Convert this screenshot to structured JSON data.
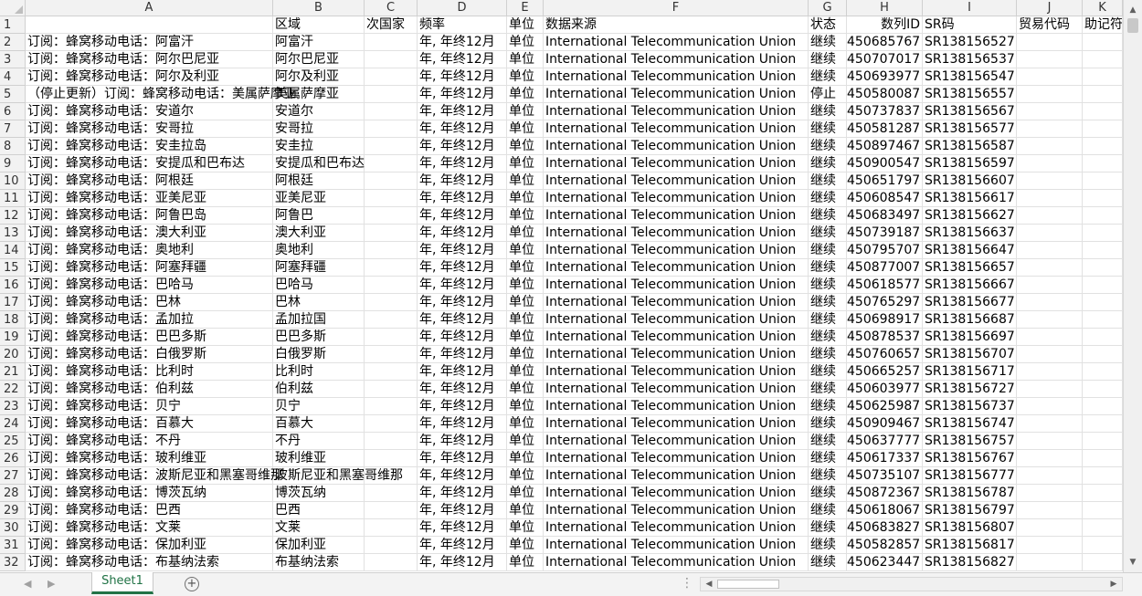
{
  "columns": [
    "A",
    "B",
    "C",
    "D",
    "E",
    "F",
    "G",
    "H",
    "I",
    "J",
    "K"
  ],
  "header_row": {
    "num": "1",
    "cells": [
      "",
      "区域",
      "次国家",
      "频率",
      "单位",
      "数据来源",
      "状态",
      "数列ID",
      "SR码",
      "贸易代码",
      "助记符"
    ]
  },
  "rows": [
    {
      "num": "2",
      "a": "订阅：蜂窝移动电话：阿富汗",
      "b": "阿富汗",
      "d": "年, 年终12月",
      "e": "单位",
      "f": "International Telecommunication Union",
      "g": "继续",
      "h": "450685767",
      "i": "SR138156527"
    },
    {
      "num": "3",
      "a": "订阅：蜂窝移动电话：阿尔巴尼亚",
      "b": "阿尔巴尼亚",
      "d": "年, 年终12月",
      "e": "单位",
      "f": "International Telecommunication Union",
      "g": "继续",
      "h": "450707017",
      "i": "SR138156537"
    },
    {
      "num": "4",
      "a": "订阅：蜂窝移动电话：阿尔及利亚",
      "b": "阿尔及利亚",
      "d": "年, 年终12月",
      "e": "单位",
      "f": "International Telecommunication Union",
      "g": "继续",
      "h": "450693977",
      "i": "SR138156547"
    },
    {
      "num": "5",
      "a": "（停止更新）订阅：蜂窝移动电话：美属萨摩亚",
      "b": "美属萨摩亚",
      "d": "年, 年终12月",
      "e": "单位",
      "f": "International Telecommunication Union",
      "g": "停止",
      "h": "450580087",
      "i": "SR138156557"
    },
    {
      "num": "6",
      "a": "订阅：蜂窝移动电话：安道尔",
      "b": "安道尔",
      "d": "年, 年终12月",
      "e": "单位",
      "f": "International Telecommunication Union",
      "g": "继续",
      "h": "450737837",
      "i": "SR138156567"
    },
    {
      "num": "7",
      "a": "订阅：蜂窝移动电话：安哥拉",
      "b": "安哥拉",
      "d": "年, 年终12月",
      "e": "单位",
      "f": "International Telecommunication Union",
      "g": "继续",
      "h": "450581287",
      "i": "SR138156577"
    },
    {
      "num": "8",
      "a": "订阅：蜂窝移动电话：安圭拉岛",
      "b": "安圭拉",
      "d": "年, 年终12月",
      "e": "单位",
      "f": "International Telecommunication Union",
      "g": "继续",
      "h": "450897467",
      "i": "SR138156587"
    },
    {
      "num": "9",
      "a": "订阅：蜂窝移动电话：安提瓜和巴布达",
      "b": "安提瓜和巴布达",
      "d": "年, 年终12月",
      "e": "单位",
      "f": "International Telecommunication Union",
      "g": "继续",
      "h": "450900547",
      "i": "SR138156597"
    },
    {
      "num": "10",
      "a": "订阅：蜂窝移动电话：阿根廷",
      "b": "阿根廷",
      "d": "年, 年终12月",
      "e": "单位",
      "f": "International Telecommunication Union",
      "g": "继续",
      "h": "450651797",
      "i": "SR138156607"
    },
    {
      "num": "11",
      "a": "订阅：蜂窝移动电话：亚美尼亚",
      "b": "亚美尼亚",
      "d": "年, 年终12月",
      "e": "单位",
      "f": "International Telecommunication Union",
      "g": "继续",
      "h": "450608547",
      "i": "SR138156617"
    },
    {
      "num": "12",
      "a": "订阅：蜂窝移动电话：阿鲁巴岛",
      "b": "阿鲁巴",
      "d": "年, 年终12月",
      "e": "单位",
      "f": "International Telecommunication Union",
      "g": "继续",
      "h": "450683497",
      "i": "SR138156627"
    },
    {
      "num": "13",
      "a": "订阅：蜂窝移动电话：澳大利亚",
      "b": "澳大利亚",
      "d": "年, 年终12月",
      "e": "单位",
      "f": "International Telecommunication Union",
      "g": "继续",
      "h": "450739187",
      "i": "SR138156637"
    },
    {
      "num": "14",
      "a": "订阅：蜂窝移动电话：奥地利",
      "b": "奥地利",
      "d": "年, 年终12月",
      "e": "单位",
      "f": "International Telecommunication Union",
      "g": "继续",
      "h": "450795707",
      "i": "SR138156647"
    },
    {
      "num": "15",
      "a": "订阅：蜂窝移动电话：阿塞拜疆",
      "b": "阿塞拜疆",
      "d": "年, 年终12月",
      "e": "单位",
      "f": "International Telecommunication Union",
      "g": "继续",
      "h": "450877007",
      "i": "SR138156657"
    },
    {
      "num": "16",
      "a": "订阅：蜂窝移动电话：巴哈马",
      "b": "巴哈马",
      "d": "年, 年终12月",
      "e": "单位",
      "f": "International Telecommunication Union",
      "g": "继续",
      "h": "450618577",
      "i": "SR138156667"
    },
    {
      "num": "17",
      "a": "订阅：蜂窝移动电话：巴林",
      "b": "巴林",
      "d": "年, 年终12月",
      "e": "单位",
      "f": "International Telecommunication Union",
      "g": "继续",
      "h": "450765297",
      "i": "SR138156677"
    },
    {
      "num": "18",
      "a": "订阅：蜂窝移动电话：孟加拉",
      "b": "孟加拉国",
      "d": "年, 年终12月",
      "e": "单位",
      "f": "International Telecommunication Union",
      "g": "继续",
      "h": "450698917",
      "i": "SR138156687"
    },
    {
      "num": "19",
      "a": "订阅：蜂窝移动电话：巴巴多斯",
      "b": "巴巴多斯",
      "d": "年, 年终12月",
      "e": "单位",
      "f": "International Telecommunication Union",
      "g": "继续",
      "h": "450878537",
      "i": "SR138156697"
    },
    {
      "num": "20",
      "a": "订阅：蜂窝移动电话：白俄罗斯",
      "b": "白俄罗斯",
      "d": "年, 年终12月",
      "e": "单位",
      "f": "International Telecommunication Union",
      "g": "继续",
      "h": "450760657",
      "i": "SR138156707"
    },
    {
      "num": "21",
      "a": "订阅：蜂窝移动电话：比利时",
      "b": "比利时",
      "d": "年, 年终12月",
      "e": "单位",
      "f": "International Telecommunication Union",
      "g": "继续",
      "h": "450665257",
      "i": "SR138156717"
    },
    {
      "num": "22",
      "a": "订阅：蜂窝移动电话：伯利兹",
      "b": "伯利兹",
      "d": "年, 年终12月",
      "e": "单位",
      "f": "International Telecommunication Union",
      "g": "继续",
      "h": "450603977",
      "i": "SR138156727"
    },
    {
      "num": "23",
      "a": "订阅：蜂窝移动电话：贝宁",
      "b": "贝宁",
      "d": "年, 年终12月",
      "e": "单位",
      "f": "International Telecommunication Union",
      "g": "继续",
      "h": "450625987",
      "i": "SR138156737"
    },
    {
      "num": "24",
      "a": "订阅：蜂窝移动电话：百慕大",
      "b": "百慕大",
      "d": "年, 年终12月",
      "e": "单位",
      "f": "International Telecommunication Union",
      "g": "继续",
      "h": "450909467",
      "i": "SR138156747"
    },
    {
      "num": "25",
      "a": "订阅：蜂窝移动电话：不丹",
      "b": "不丹",
      "d": "年, 年终12月",
      "e": "单位",
      "f": "International Telecommunication Union",
      "g": "继续",
      "h": "450637777",
      "i": "SR138156757"
    },
    {
      "num": "26",
      "a": "订阅：蜂窝移动电话：玻利维亚",
      "b": "玻利维亚",
      "d": "年, 年终12月",
      "e": "单位",
      "f": "International Telecommunication Union",
      "g": "继续",
      "h": "450617337",
      "i": "SR138156767"
    },
    {
      "num": "27",
      "a": "订阅：蜂窝移动电话：波斯尼亚和黑塞哥维那",
      "b": "波斯尼亚和黑塞哥维那",
      "d": "年, 年终12月",
      "e": "单位",
      "f": "International Telecommunication Union",
      "g": "继续",
      "h": "450735107",
      "i": "SR138156777"
    },
    {
      "num": "28",
      "a": "订阅：蜂窝移动电话：博茨瓦纳",
      "b": "博茨瓦纳",
      "d": "年, 年终12月",
      "e": "单位",
      "f": "International Telecommunication Union",
      "g": "继续",
      "h": "450872367",
      "i": "SR138156787"
    },
    {
      "num": "29",
      "a": "订阅：蜂窝移动电话：巴西",
      "b": "巴西",
      "d": "年, 年终12月",
      "e": "单位",
      "f": "International Telecommunication Union",
      "g": "继续",
      "h": "450618067",
      "i": "SR138156797"
    },
    {
      "num": "30",
      "a": "订阅：蜂窝移动电话：文莱",
      "b": "文莱",
      "d": "年, 年终12月",
      "e": "单位",
      "f": "International Telecommunication Union",
      "g": "继续",
      "h": "450683827",
      "i": "SR138156807"
    },
    {
      "num": "31",
      "a": "订阅：蜂窝移动电话：保加利亚",
      "b": "保加利亚",
      "d": "年, 年终12月",
      "e": "单位",
      "f": "International Telecommunication Union",
      "g": "继续",
      "h": "450582857",
      "i": "SR138156817"
    },
    {
      "num": "32",
      "a": "订阅：蜂窝移动电话：布基纳法索",
      "b": "布基纳法索",
      "d": "年, 年终12月",
      "e": "单位",
      "f": "International Telecommunication Union",
      "g": "继续",
      "h": "450623447",
      "i": "SR138156827"
    }
  ],
  "bottom_bar": {
    "sheet_tab": "Sheet1",
    "add_sheet_symbol": "+",
    "nav_prev": "◀",
    "nav_next": "▶",
    "options_dots": "⋮",
    "scroll_left": "◀",
    "scroll_right": "▶"
  },
  "vertical_scroll": {
    "up": "▲",
    "down": "▼"
  },
  "colors": {
    "accent": "#217346",
    "header_bg": "#f2f2f2",
    "gridline": "#e1e1e1"
  }
}
